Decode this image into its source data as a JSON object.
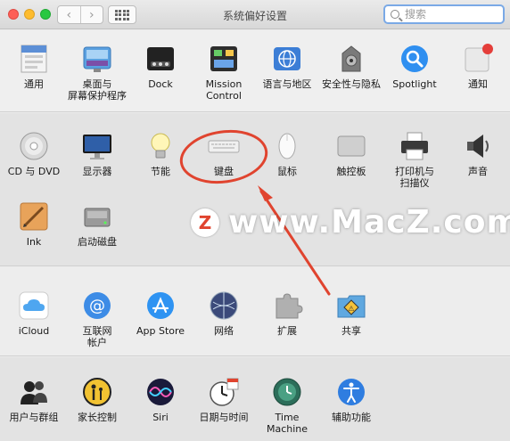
{
  "window": {
    "title": "系统偏好设置"
  },
  "toolbar": {
    "back": "‹",
    "forward": "›"
  },
  "search": {
    "placeholder": "搜索"
  },
  "rows": {
    "row1": [
      {
        "label": "通用",
        "icon": "general-icon"
      },
      {
        "label": "桌面与\n屏幕保护程序",
        "icon": "desktop-screensaver-icon"
      },
      {
        "label": "Dock",
        "icon": "dock-icon"
      },
      {
        "label": "Mission\nControl",
        "icon": "mission-control-icon"
      },
      {
        "label": "语言与地区",
        "icon": "language-region-icon"
      },
      {
        "label": "安全性与隐私",
        "icon": "security-privacy-icon"
      },
      {
        "label": "Spotlight",
        "icon": "spotlight-icon"
      },
      {
        "label": "通知",
        "icon": "notifications-icon"
      }
    ],
    "row2": [
      {
        "label": "CD 与 DVD",
        "icon": "cd-dvd-icon"
      },
      {
        "label": "显示器",
        "icon": "displays-icon"
      },
      {
        "label": "节能",
        "icon": "energy-saver-icon"
      },
      {
        "label": "键盘",
        "icon": "keyboard-icon"
      },
      {
        "label": "鼠标",
        "icon": "mouse-icon"
      },
      {
        "label": "触控板",
        "icon": "trackpad-icon"
      },
      {
        "label": "打印机与\n扫描仪",
        "icon": "printers-scanners-icon"
      },
      {
        "label": "声音",
        "icon": "sound-icon"
      }
    ],
    "row3": [
      {
        "label": "Ink",
        "icon": "ink-icon"
      },
      {
        "label": "启动磁盘",
        "icon": "startup-disk-icon"
      }
    ],
    "row4": [
      {
        "label": "iCloud",
        "icon": "icloud-icon"
      },
      {
        "label": "互联网\n帐户",
        "icon": "internet-accounts-icon"
      },
      {
        "label": "App Store",
        "icon": "app-store-icon"
      },
      {
        "label": "网络",
        "icon": "network-icon"
      },
      {
        "label": "扩展",
        "icon": "extensions-icon"
      },
      {
        "label": "共享",
        "icon": "sharing-icon"
      }
    ],
    "row5": [
      {
        "label": "用户与群组",
        "icon": "users-groups-icon"
      },
      {
        "label": "家长控制",
        "icon": "parental-controls-icon"
      },
      {
        "label": "Siri",
        "icon": "siri-icon"
      },
      {
        "label": "日期与时间",
        "icon": "date-time-icon"
      },
      {
        "label": "Time Machine",
        "icon": "time-machine-icon"
      },
      {
        "label": "辅助功能",
        "icon": "accessibility-icon"
      }
    ]
  },
  "watermark": {
    "logo": "Z",
    "text": "www.MacZ.com"
  },
  "colors": {
    "annotation": "#e0442f",
    "search_focus": "#7aa9e6"
  }
}
